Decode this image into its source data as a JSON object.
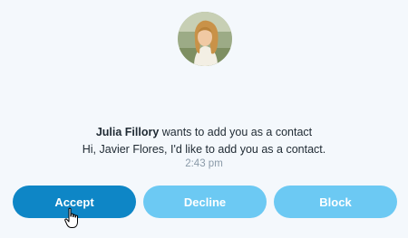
{
  "request": {
    "sender_name": "Julia Fillory",
    "request_text": " wants to add you as a contact",
    "greeting": "Hi, Javier Flores, I'd like to add you as a contact.",
    "time": "2:43 pm"
  },
  "actions": {
    "accept_label": "Accept",
    "decline_label": "Decline",
    "block_label": "Block"
  },
  "colors": {
    "accept": "#0e86c6",
    "secondary": "#6cc9f3",
    "background": "#f4f8fc"
  },
  "icons": {
    "avatar": "user-photo",
    "cursor": "hand-pointer-icon"
  }
}
